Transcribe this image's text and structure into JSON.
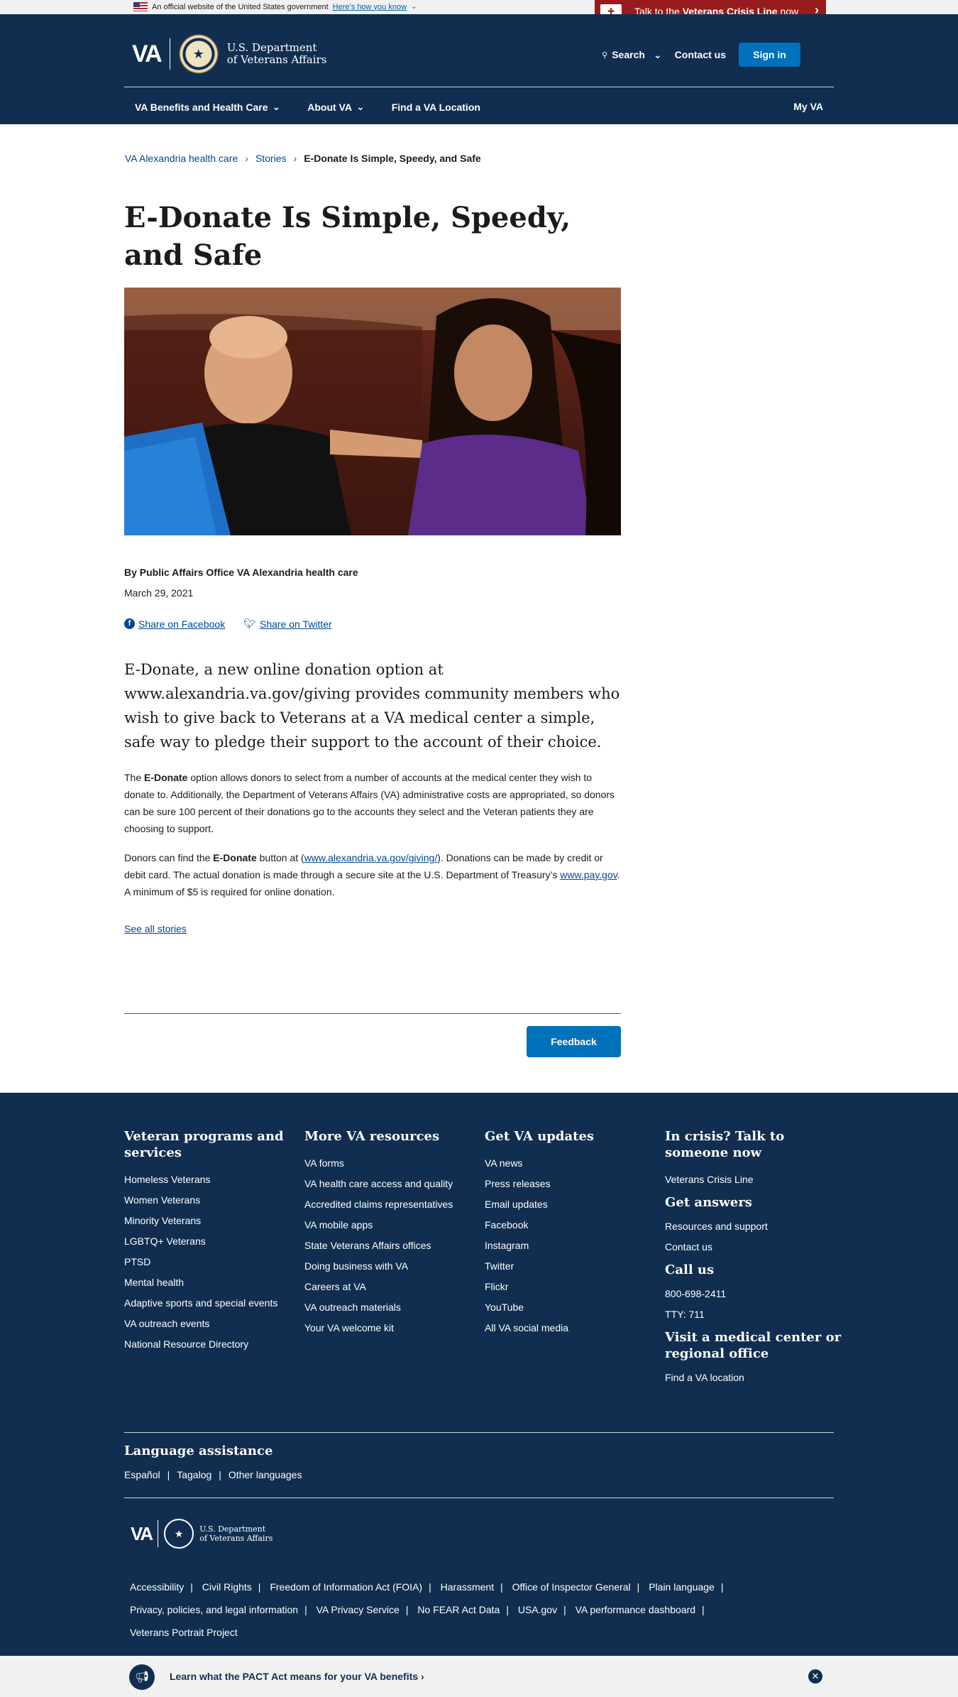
{
  "gov_banner": {
    "official_text": "An official website of the United States government",
    "how_know": "Here’s how you know"
  },
  "crisis": {
    "prefix": "Talk to the ",
    "bold": "Veterans Crisis Line",
    "suffix": " now"
  },
  "header": {
    "logo_text": "VA",
    "dept_line1": "U.S. Department",
    "dept_line2": "of Veterans Affairs",
    "search_label": "Search",
    "contact_label": "Contact us",
    "signin_label": "Sign in"
  },
  "nav": {
    "items": [
      {
        "label": "VA Benefits and Health Care"
      },
      {
        "label": "About VA"
      },
      {
        "label": "Find a VA Location"
      }
    ],
    "myva": "My VA"
  },
  "breadcrumb": {
    "items": [
      "VA Alexandria health care",
      "Stories"
    ],
    "current": "E-Donate Is Simple, Speedy, and Safe"
  },
  "article": {
    "title": "E-Donate Is Simple, Speedy, and Safe",
    "byline": "By Public Affairs Office VA Alexandria health care",
    "date": "March 29, 2021",
    "share_facebook": "Share on Facebook",
    "share_twitter": "Share on Twitter",
    "lede": "E-Donate, a new online donation option at www.alexandria.va.gov/giving provides community members who wish to give back to Veterans at a VA medical center a simple, safe way to pledge their support to the account of their choice.",
    "p1_before": "The ",
    "p1_bold": "E-Donate",
    "p1_after": " option allows donors to select from a number of accounts at the medical center they wish to donate to. Additionally, the Department of Veterans Affairs (VA) administrative costs are appropriated, so donors can be sure 100 percent of their donations go to the accounts they select and the Veteran patients they are choosing to support.",
    "p2_a": "Donors can find the ",
    "p2_bold": "E-Donate",
    "p2_b": " button at (",
    "p2_link1": "www.alexandria.va.gov/giving/",
    "p2_c": "). Donations can be made by credit or debit card. The actual donation is made through a secure site at the U.S. Department of Treasury’s ",
    "p2_link2": "www.pay.gov",
    "p2_d": ". A minimum of $5 is required for online donation.",
    "see_all": "See all stories",
    "feedback": "Feedback"
  },
  "footer": {
    "col1": {
      "title": "Veteran programs and services",
      "links": [
        "Homeless Veterans",
        "Women Veterans",
        "Minority Veterans",
        "LGBTQ+ Veterans",
        "PTSD",
        "Mental health",
        "Adaptive sports and special events",
        "VA outreach events",
        "National Resource Directory"
      ]
    },
    "col2": {
      "title": "More VA resources",
      "links": [
        "VA forms",
        "VA health care access and quality",
        "Accredited claims representatives",
        "VA mobile apps",
        "State Veterans Affairs offices",
        "Doing business with VA",
        "Careers at VA",
        "VA outreach materials",
        "Your VA welcome kit"
      ]
    },
    "col3": {
      "title": "Get VA updates",
      "links": [
        "VA news",
        "Press releases",
        "Email updates",
        "Facebook",
        "Instagram",
        "Twitter",
        "Flickr",
        "YouTube",
        "All VA social media"
      ]
    },
    "col4": {
      "crisis_title": "In crisis? Talk to someone now",
      "crisis_link": "Veterans Crisis Line",
      "answers_title": "Get answers",
      "answers_links": [
        "Resources and support",
        "Contact us"
      ],
      "call_title": "Call us",
      "call_links": [
        "800-698-2411",
        "TTY: 711"
      ],
      "visit_title": "Visit a medical center or regional office",
      "visit_link": "Find a VA location"
    },
    "language": {
      "title": "Language assistance",
      "links": [
        "Español",
        "Tagalog",
        "Other languages"
      ]
    },
    "logo": {
      "va": "VA",
      "dept_line1": "U.S. Department",
      "dept_line2": "of Veterans Affairs"
    },
    "bottom_links": [
      "Accessibility",
      "Civil Rights",
      "Freedom of Information Act (FOIA)",
      "Harassment",
      "Office of Inspector General",
      "Plain language",
      "Privacy, policies, and legal information",
      "VA Privacy Service",
      "No FEAR Act Data",
      "USA.gov",
      "VA performance dashboard",
      "Veterans Portrait Project"
    ]
  },
  "pact_banner": {
    "message": "Learn what the PACT Act means for your VA benefits"
  },
  "colors": {
    "navy": "#112e51",
    "link_blue": "#004795",
    "button_blue": "#0071bb",
    "crisis_red": "#981b1e"
  }
}
